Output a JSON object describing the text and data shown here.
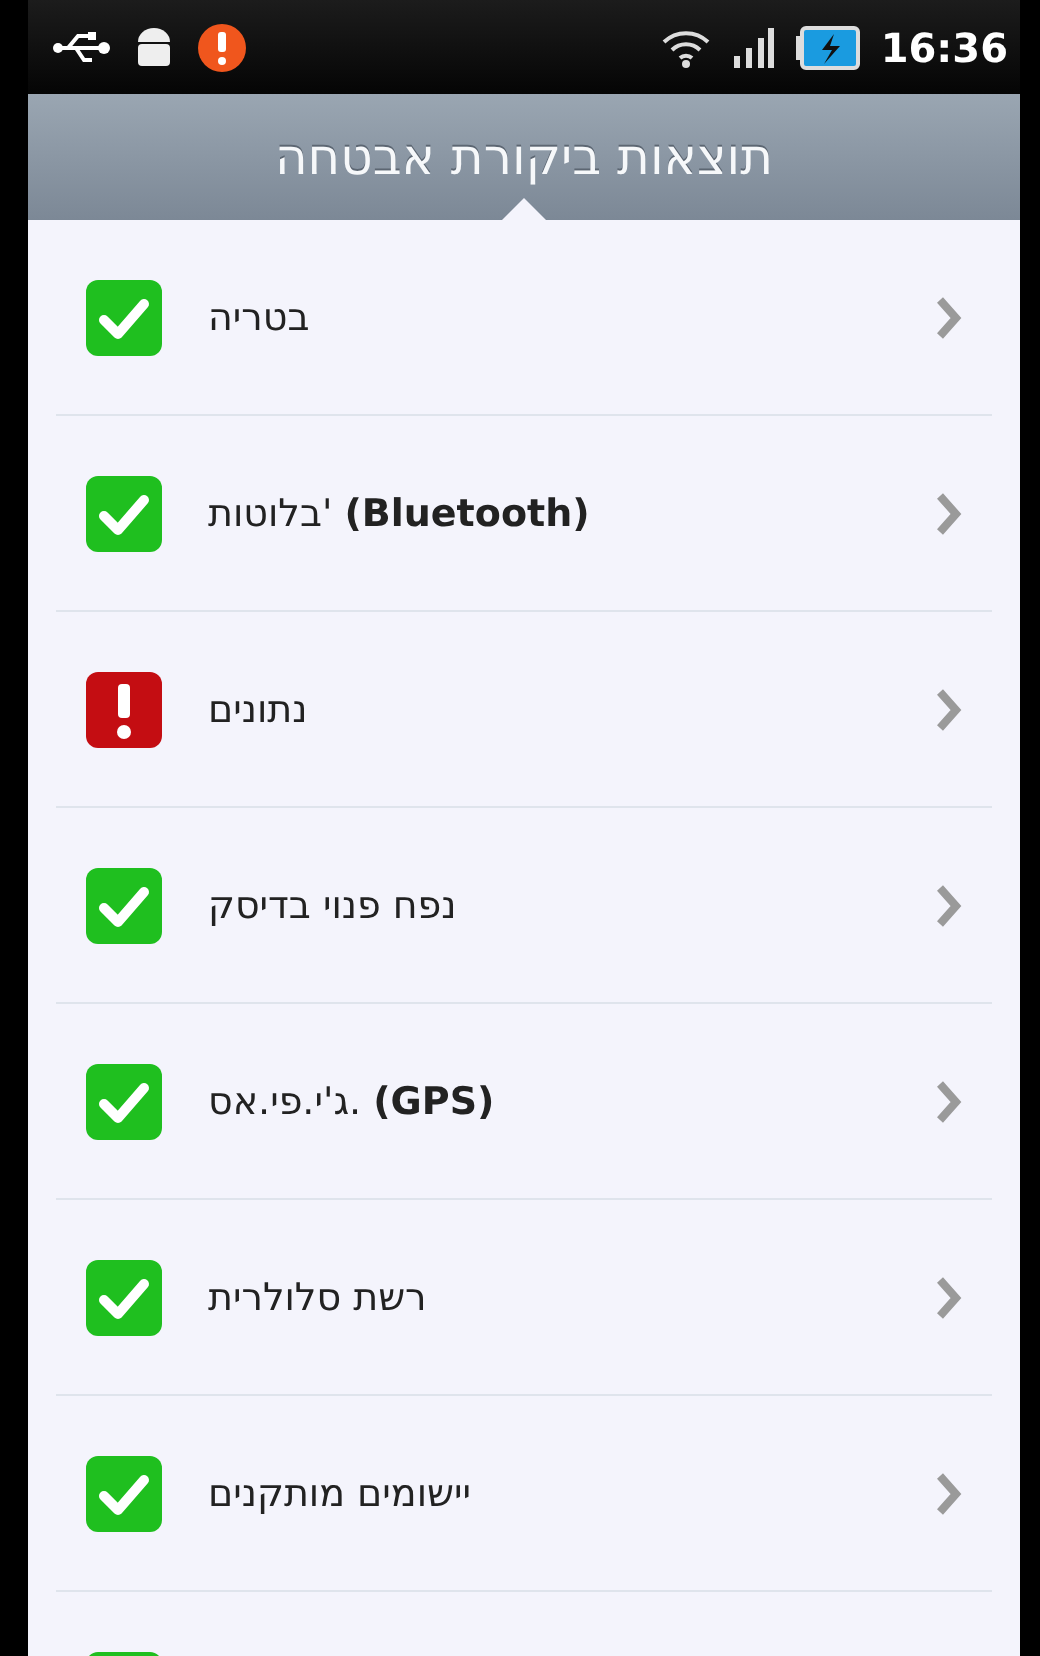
{
  "status_bar": {
    "time": "16:36"
  },
  "header": {
    "title": "תוצאות ביקורת אבטחה"
  },
  "items": [
    {
      "label": "בטריה",
      "kind": "ok"
    },
    {
      "label": "בלוטות' **(Bluetooth)**",
      "kind": "ok"
    },
    {
      "label": "נתונים",
      "kind": "error"
    },
    {
      "label": "נפח פנוי בדיסק",
      "kind": "ok"
    },
    {
      "label": "ג'י.פי.אס. **(GPS)**",
      "kind": "ok"
    },
    {
      "label": "רשת סלולרית",
      "kind": "ok"
    },
    {
      "label": "יישומים מותקנים",
      "kind": "ok"
    },
    {
      "kind": "ok"
    }
  ]
}
